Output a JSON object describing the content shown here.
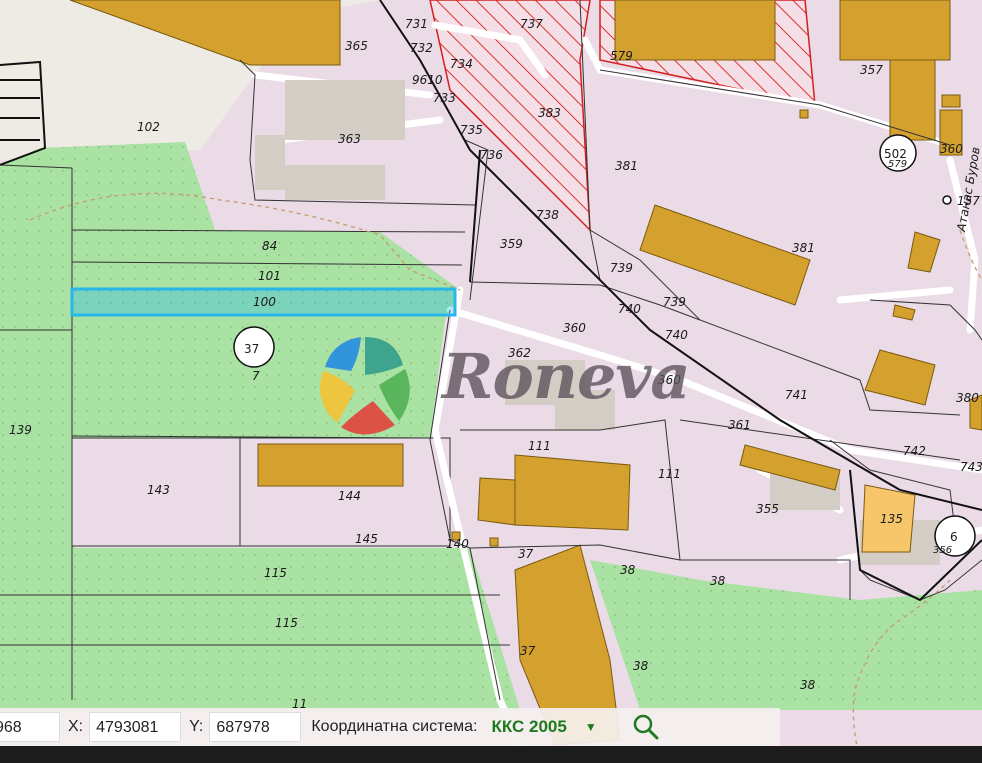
{
  "map": {
    "parcels": {
      "p731": "731",
      "p737": "737",
      "p365": "365",
      "p732": "732",
      "p734": "734",
      "p9610": "9610",
      "p733": "733",
      "p579a": "579",
      "p357": "357",
      "p102": "102",
      "p363": "363",
      "p735": "735",
      "p383": "383",
      "p736": "736",
      "p381a": "381",
      "p579b": "579",
      "p360a": "360",
      "p157": "157",
      "p738": "738",
      "p84": "84",
      "p359": "359",
      "p381b": "381",
      "p101": "101",
      "p739a": "739",
      "p100": "100",
      "p740a": "740",
      "p739b": "739",
      "p360b": "360",
      "p740b": "740",
      "p7": "7",
      "p362": "362",
      "p360c": "360",
      "p139": "139",
      "p741": "741",
      "p380": "380",
      "p361": "361",
      "p111a": "111",
      "p111b": "111",
      "p742": "742",
      "p743": "743",
      "p143": "143",
      "p144": "144",
      "p355": "355",
      "p135": "135",
      "p356": "356",
      "p145": "145",
      "p140": "140",
      "p37a": "37",
      "p38a": "38",
      "p38b": "38",
      "p115a": "115",
      "p115b": "115",
      "p37b": "37",
      "p38c": "38",
      "p38d": "38",
      "p11": "11"
    },
    "circles": {
      "c502": "502",
      "c37": "37",
      "c6": "6"
    },
    "street_label": "Атанас Буров"
  },
  "watermark": {
    "brand": "Roneva"
  },
  "coordinates": {
    "first_value": "968",
    "x_label": "X:",
    "x_value": "4793081",
    "y_label": "Y:",
    "y_value": "687978",
    "system_label": "Координатна система:",
    "system_value": "ККС 2005"
  },
  "icons": {
    "dropdown": "triangle-down-icon",
    "search": "magnifier-icon"
  },
  "colors": {
    "urban": "#eadbe6",
    "green": "#a9e2a3",
    "building": "#d4a12f",
    "selected": "#29b6e8",
    "hatch": "#e03030",
    "accent": "#1f7a1f"
  }
}
